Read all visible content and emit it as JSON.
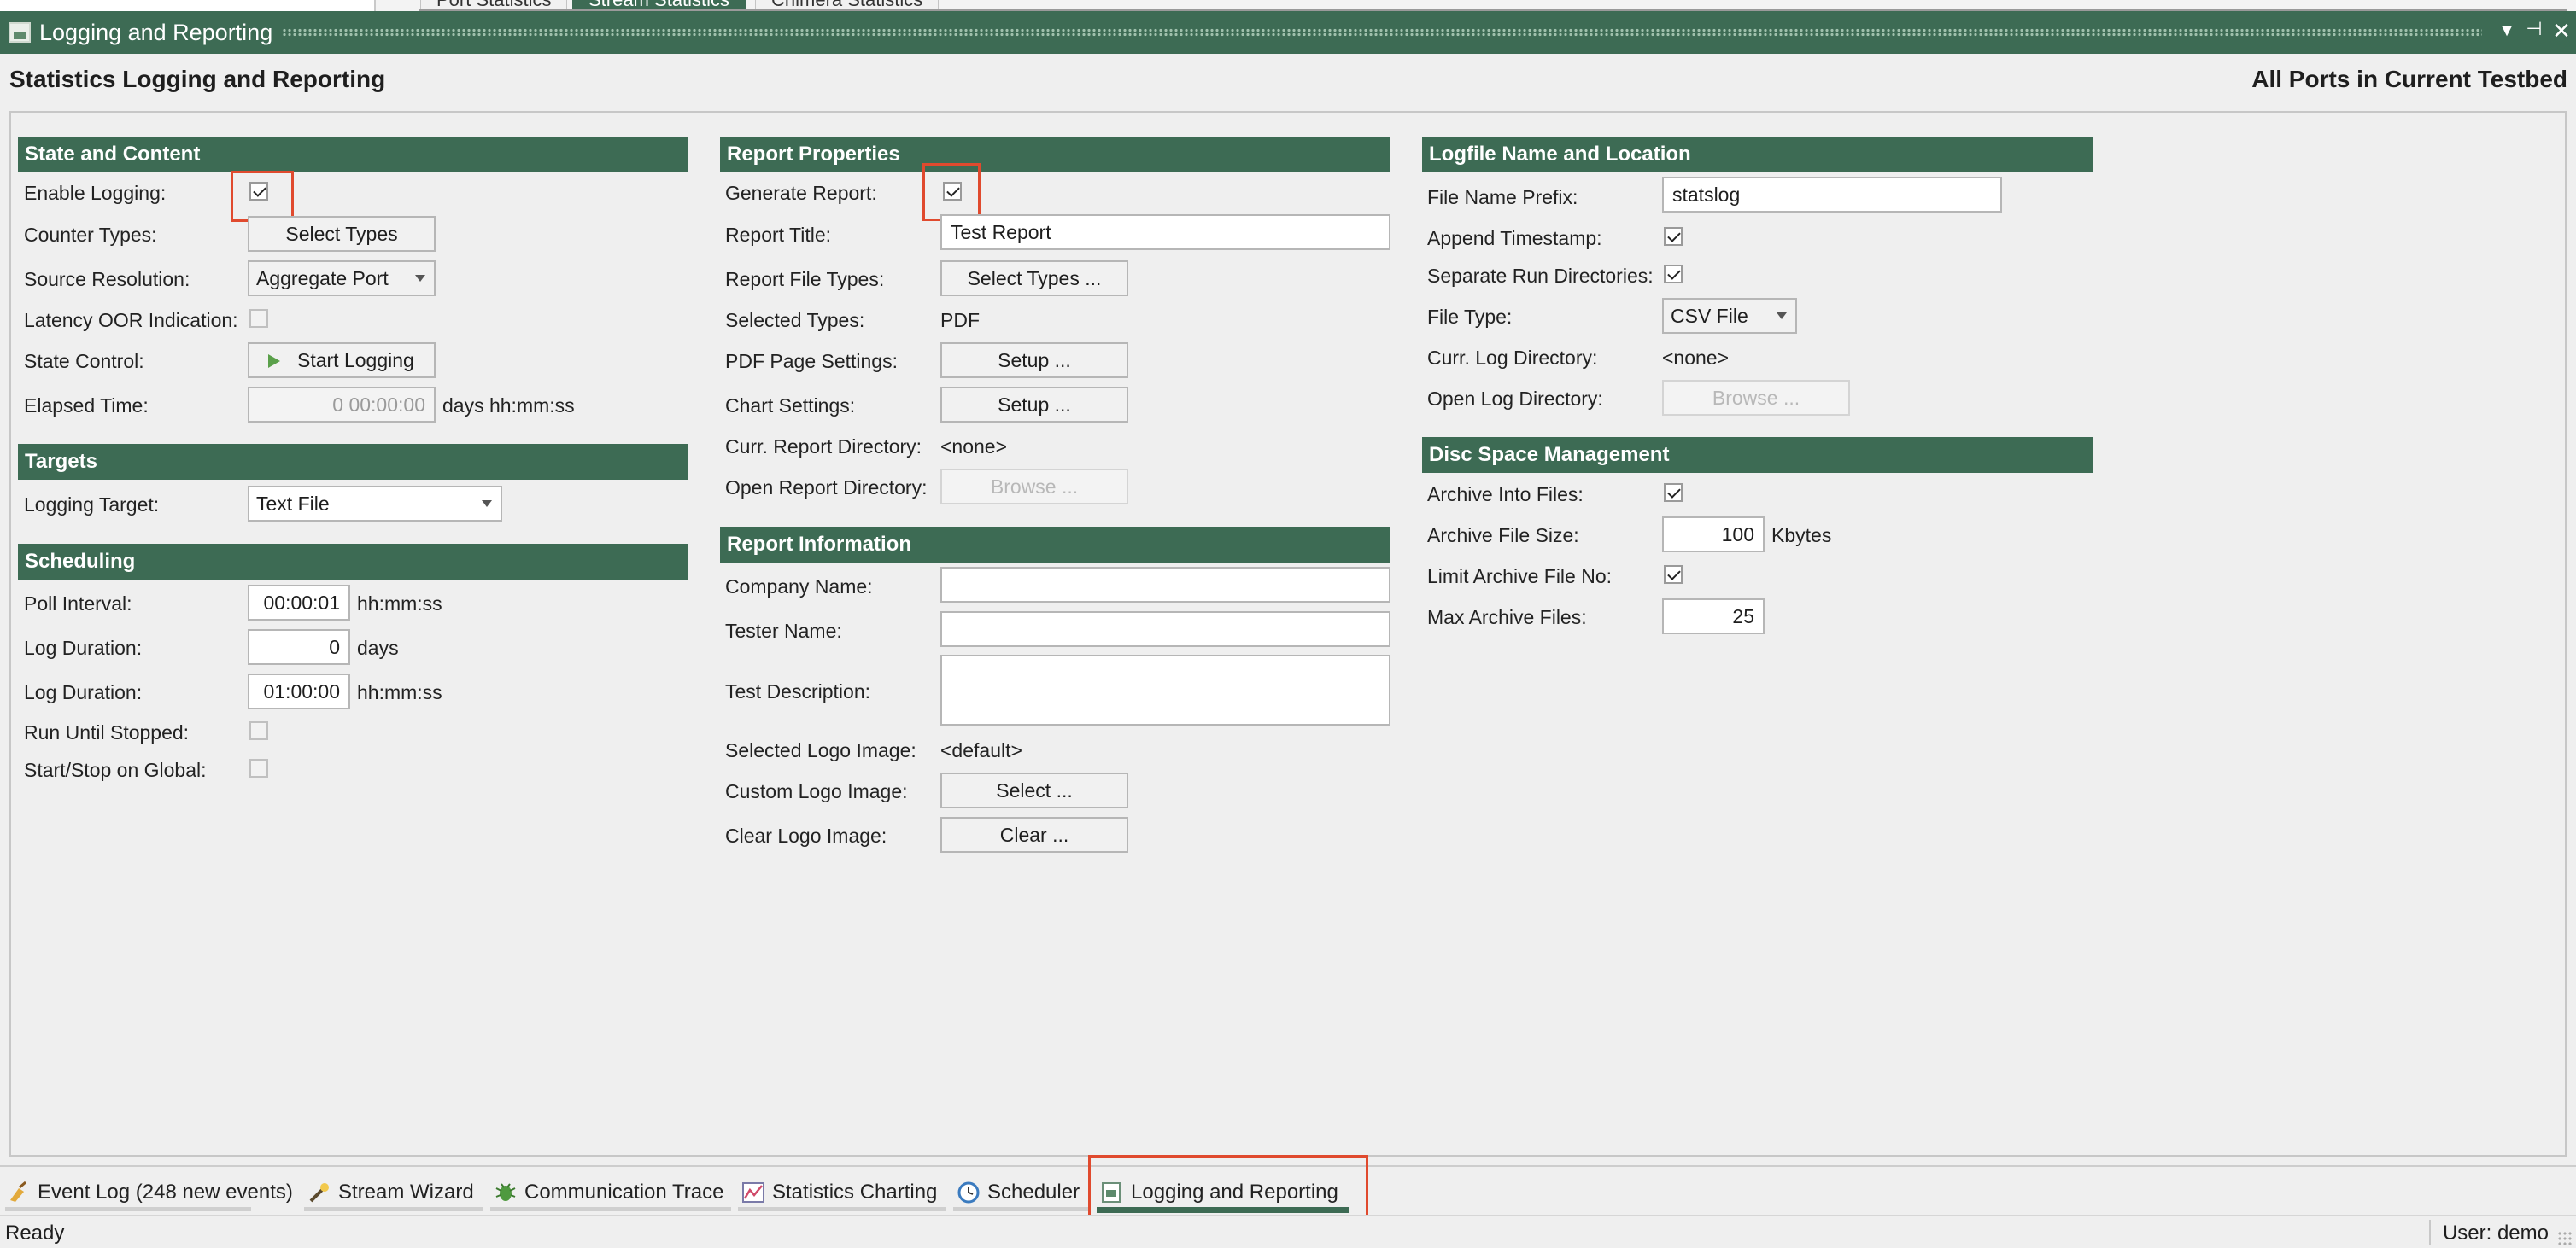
{
  "top_tabs": [
    "Port Statistics",
    "Stream Statistics",
    "Chimera Statistics"
  ],
  "window": {
    "title": "Logging and Reporting"
  },
  "header": {
    "title": "Statistics Logging and Reporting",
    "scope": "All Ports in Current Testbed"
  },
  "state_content": {
    "title": "State and Content",
    "enable_logging_label": "Enable Logging:",
    "counter_types_label": "Counter Types:",
    "counter_types_button": "Select Types",
    "source_resolution_label": "Source Resolution:",
    "source_resolution_value": "Aggregate Port",
    "latency_label": "Latency OOR Indication:",
    "state_control_label": "State Control:",
    "state_control_button": "Start Logging",
    "elapsed_label": "Elapsed Time:",
    "elapsed_value": "0 00:00:00",
    "elapsed_unit": "days hh:mm:ss"
  },
  "targets": {
    "title": "Targets",
    "logging_target_label": "Logging Target:",
    "logging_target_value": "Text File"
  },
  "scheduling": {
    "title": "Scheduling",
    "poll_label": "Poll Interval:",
    "poll_value": "00:00:01",
    "poll_unit": "hh:mm:ss",
    "log_duration_days_label": "Log Duration:",
    "log_duration_days_value": "0",
    "log_duration_days_unit": "days",
    "log_duration_time_label": "Log Duration:",
    "log_duration_time_value": "01:00:00",
    "log_duration_time_unit": "hh:mm:ss",
    "run_until_label": "Run Until Stopped:",
    "start_stop_label": "Start/Stop on Global:"
  },
  "report_properties": {
    "title": "Report Properties",
    "generate_label": "Generate Report:",
    "report_title_label": "Report Title:",
    "report_title_value": "Test Report",
    "file_types_label": "Report File Types:",
    "file_types_button": "Select Types ...",
    "selected_types_label": "Selected Types:",
    "selected_types_value": "PDF",
    "pdf_label": "PDF Page Settings:",
    "pdf_button": "Setup ...",
    "chart_label": "Chart Settings:",
    "chart_button": "Setup ...",
    "curr_dir_label": "Curr. Report Directory:",
    "curr_dir_value": "<none>",
    "open_dir_label": "Open Report Directory:",
    "open_dir_button": "Browse ..."
  },
  "report_info": {
    "title": "Report Information",
    "company_label": "Company Name:",
    "company_value": "",
    "tester_label": "Tester Name:",
    "tester_value": "",
    "description_label": "Test Description:",
    "description_value": "",
    "selected_logo_label": "Selected Logo Image:",
    "selected_logo_value": "<default>",
    "custom_logo_label": "Custom Logo Image:",
    "custom_logo_button": "Select ...",
    "clear_logo_label": "Clear Logo Image:",
    "clear_logo_button": "Clear ..."
  },
  "logfile": {
    "title": "Logfile Name and Location",
    "prefix_label": "File Name Prefix:",
    "prefix_value": "statslog",
    "append_label": "Append Timestamp:",
    "separate_label": "Separate Run Directories:",
    "file_type_label": "File Type:",
    "file_type_value": "CSV File",
    "curr_dir_label": "Curr. Log Directory:",
    "curr_dir_value": "<none>",
    "open_dir_label": "Open Log Directory:",
    "open_dir_button": "Browse ..."
  },
  "disc_space": {
    "title": "Disc Space Management",
    "archive_into_label": "Archive Into Files:",
    "archive_size_label": "Archive File Size:",
    "archive_size_value": "100",
    "archive_size_unit": "Kbytes",
    "limit_label": "Limit Archive File No:",
    "max_label": "Max Archive Files:",
    "max_value": "25"
  },
  "bottom_tabs": [
    {
      "label": "Event Log (248 new events)",
      "icon": "broom-icon"
    },
    {
      "label": "Stream Wizard",
      "icon": "wand-icon"
    },
    {
      "label": "Communication Trace",
      "icon": "bug-icon"
    },
    {
      "label": "Statistics Charting",
      "icon": "chart-icon"
    },
    {
      "label": "Scheduler",
      "icon": "clock-icon"
    },
    {
      "label": "Logging and Reporting",
      "icon": "report-icon"
    }
  ],
  "status": {
    "text": "Ready",
    "user": "User: demo"
  },
  "colors": {
    "accent": "#3d6b54",
    "highlight": "#e04a2e"
  }
}
